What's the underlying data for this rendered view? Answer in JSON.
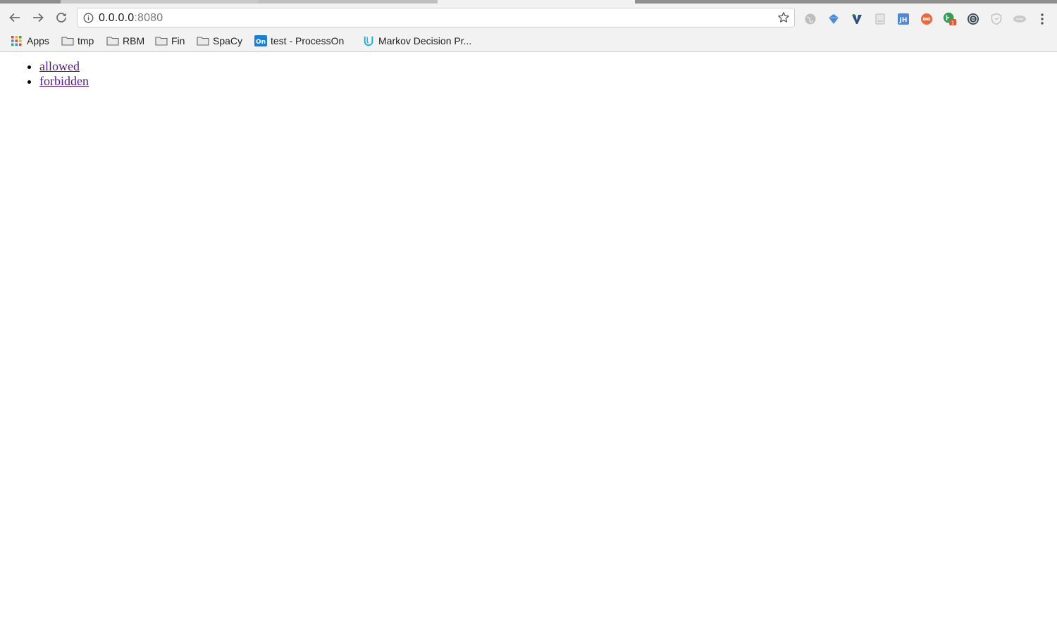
{
  "browser": {
    "url_host": "0.0.0.0",
    "url_port": ":8080"
  },
  "bookmarks": [
    {
      "label": "Apps",
      "icon": "apps-grid-icon"
    },
    {
      "label": "tmp",
      "icon": "folder-icon"
    },
    {
      "label": "RBM",
      "icon": "folder-icon"
    },
    {
      "label": "Fin",
      "icon": "folder-icon"
    },
    {
      "label": "SpaCy",
      "icon": "folder-icon"
    },
    {
      "label": "test - ProcessOn",
      "icon": "processon-icon"
    },
    {
      "label": "Markov Decision Pr...",
      "icon": "udacity-icon"
    }
  ],
  "extensions": [
    "globe-extension-icon",
    "diamond-extension-icon",
    "vimium-extension-icon",
    "page-extension-icon",
    "jh-extension-icon",
    "infinity-extension-icon",
    "green-badge-extension-icon",
    "e-extension-icon",
    "shield-extension-icon",
    "cloud-extension-icon",
    "menu-icon"
  ],
  "extension_badge": "1",
  "page": {
    "links": [
      {
        "label": "allowed"
      },
      {
        "label": "forbidden"
      }
    ]
  },
  "colors": {
    "link_visited": "#551a8b",
    "toolbar_bg": "#f2f2f2"
  }
}
